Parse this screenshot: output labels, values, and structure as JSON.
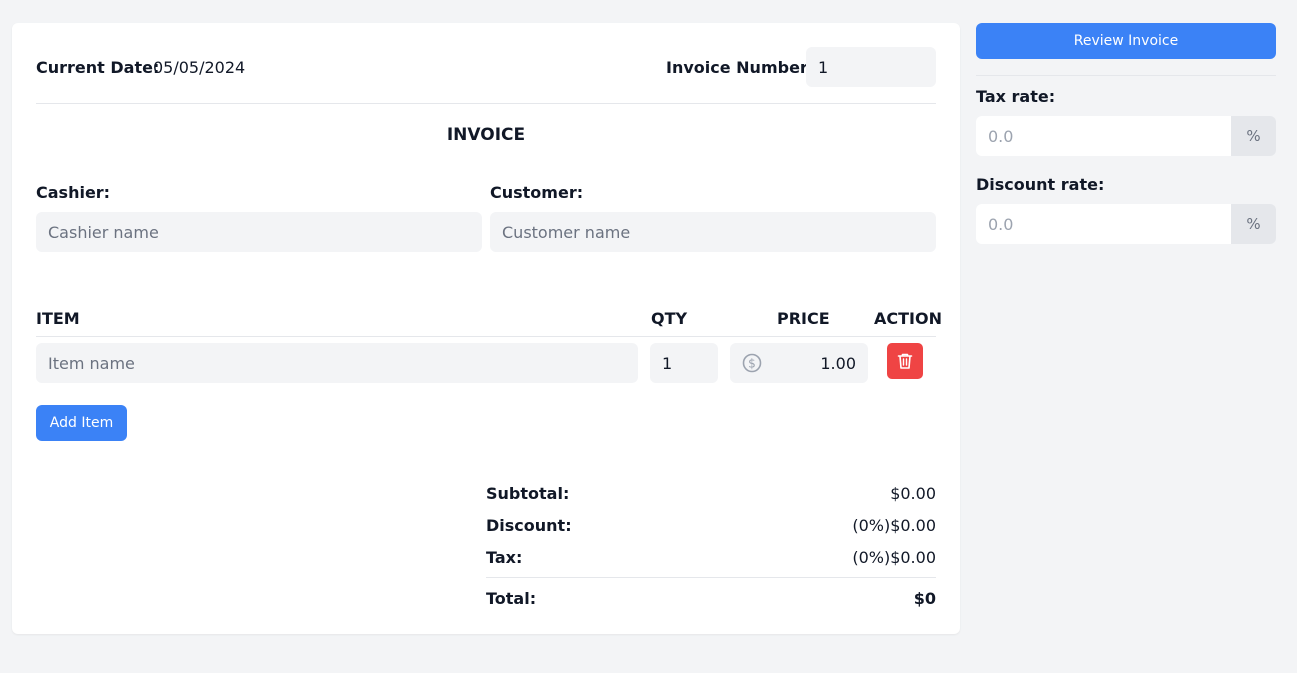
{
  "header": {
    "current_date_label": "Current Date:",
    "current_date_value": "05/05/2024",
    "invoice_number_label": "Invoice Number:",
    "invoice_number_value": "1"
  },
  "invoice": {
    "title": "INVOICE",
    "cashier_label": "Cashier:",
    "cashier_placeholder": "Cashier name",
    "customer_label": "Customer:",
    "customer_placeholder": "Customer name"
  },
  "items_table": {
    "headers": {
      "item": "ITEM",
      "qty": "QTY",
      "price": "PRICE",
      "action": "ACTION"
    },
    "rows": [
      {
        "item_placeholder": "Item name",
        "qty": "1",
        "price": "1.00"
      }
    ],
    "add_item_label": "Add Item"
  },
  "summary": {
    "subtotal_label": "Subtotal:",
    "subtotal_value": "$0.00",
    "discount_label": "Discount:",
    "discount_value": "(0%)$0.00",
    "tax_label": "Tax:",
    "tax_value": "(0%)$0.00",
    "total_label": "Total:",
    "total_value": "$0"
  },
  "sidebar": {
    "review_button": "Review Invoice",
    "tax_rate_label": "Tax rate:",
    "tax_rate_placeholder": "0.0",
    "tax_rate_unit": "%",
    "discount_rate_label": "Discount rate:",
    "discount_rate_placeholder": "0.0",
    "discount_rate_unit": "%"
  },
  "colors": {
    "primary": "#3b82f6",
    "danger": "#ef4444",
    "background": "#f3f4f6"
  }
}
